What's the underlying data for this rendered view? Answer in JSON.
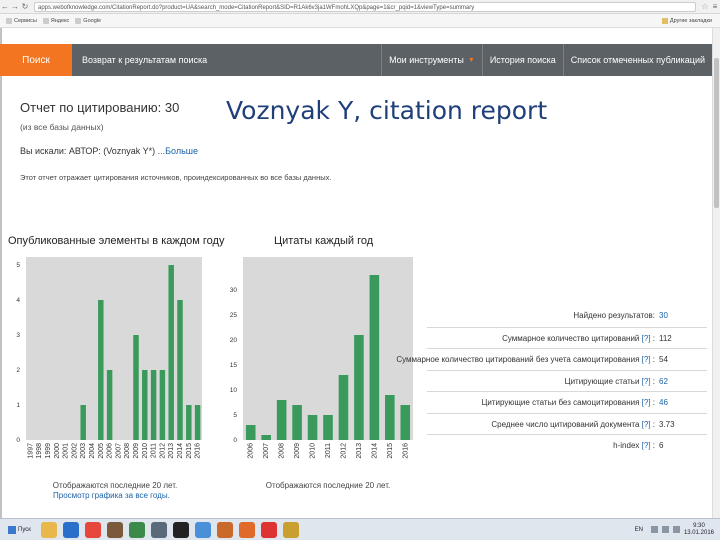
{
  "browser": {
    "url": "apps.webofknowledge.com/CitationReport.do?product=UA&search_mode=CitationReport&SID=R1Ak6v3ja1WFmohLXQp&page=1&cr_pqid=1&viewType=summary",
    "bookmarks": [
      "Сервисы",
      "Яндекс",
      "Google"
    ],
    "bookmarks_right": "Другие закладки"
  },
  "nav": {
    "search_tab": "Поиск",
    "back": "Возврат к результатам поиска",
    "my_tools": "Мои инструменты",
    "history": "История поиска",
    "marked": "Список отмеченных публикаций"
  },
  "report": {
    "title": "Отчет по цитированию: 30",
    "subtitle": "(из все базы данных)",
    "searched_prefix": "Вы искали:  АВТОР: (Voznyak Y*)",
    "searched_more": "...Больше",
    "description": "Этот отчет отражает цитирования источников, проиндексированных во все базы данных."
  },
  "overlay": {
    "title": "Voznyak Y, citation report"
  },
  "chart_data": [
    {
      "type": "bar",
      "title": "Опубликованные элементы в каждом году",
      "categories": [
        "1997",
        "1998",
        "1999",
        "2000",
        "2001",
        "2002",
        "2003",
        "2004",
        "2005",
        "2006",
        "2007",
        "2008",
        "2009",
        "2010",
        "2011",
        "2012",
        "2013",
        "2014",
        "2015",
        "2016"
      ],
      "values": [
        0,
        0,
        0,
        0,
        0,
        0,
        1,
        0,
        4,
        2,
        0,
        0,
        3,
        2,
        2,
        2,
        5,
        4,
        1,
        1
      ],
      "ylim": [
        0,
        5
      ],
      "yticks": [
        "0",
        "1",
        "2",
        "3",
        "4",
        "5"
      ],
      "caption": "Отображаются последние 20 лет.",
      "link": "Просмотр графика за все годы."
    },
    {
      "type": "bar",
      "title": "Цитаты каждый год",
      "categories": [
        "2006",
        "2007",
        "2008",
        "2009",
        "2010",
        "2011",
        "2012",
        "2013",
        "2014",
        "2015",
        "2016"
      ],
      "values": [
        3,
        1,
        8,
        7,
        5,
        5,
        13,
        21,
        33,
        9,
        7
      ],
      "ylim": [
        0,
        35
      ],
      "yticks": [
        "0",
        "5",
        "10",
        "15",
        "20",
        "25",
        "30"
      ],
      "caption": "Отображаются последние 20 лет."
    }
  ],
  "stats": [
    {
      "label": "Найдено результатов:",
      "help": "",
      "value": "30",
      "link": true
    },
    {
      "label": "Суммарное количество цитирований",
      "help": "[?]",
      "value": "112",
      "link": false
    },
    {
      "label": "Суммарное количество цитирований без учета самоцитирования",
      "help": "[?]",
      "value": "54",
      "link": false
    },
    {
      "label": "Цитирующие статьи",
      "help": "[?]",
      "value": "62",
      "link": true
    },
    {
      "label": "Цитирующие статьи без самоцитирования",
      "help": "[?]",
      "value": "46",
      "link": true
    },
    {
      "label": "Среднее число цитирований документа",
      "help": "[?]",
      "value": "3.73",
      "link": false
    },
    {
      "label": "h-index",
      "help": "[?]",
      "value": "6",
      "link": false
    }
  ],
  "taskbar": {
    "start": "Пуск",
    "lang": "EN",
    "time": "9:30",
    "date": "13.01.2016"
  },
  "colors": {
    "accent": "#f47521",
    "nav": "#5c6166",
    "bar": "#3a9a5b",
    "link": "#1a62a8",
    "overlay": "#1f3f7a"
  }
}
